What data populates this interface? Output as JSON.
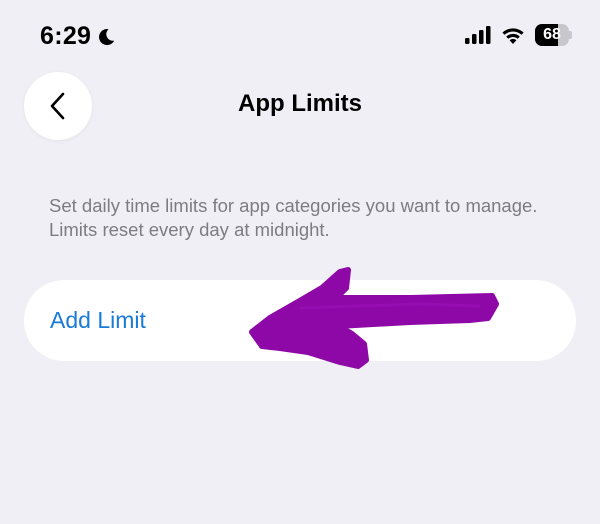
{
  "status_bar": {
    "time": "6:29",
    "focus_icon": "moon-icon",
    "signal_icon": "cellular-signal-icon",
    "wifi_icon": "wifi-icon",
    "battery_percent": "68",
    "battery_level": 0.68
  },
  "nav": {
    "back_icon": "chevron-left-icon",
    "title": "App Limits"
  },
  "description": "Set daily time limits for app categories you want to manage. Limits reset every day at midnight.",
  "add_limit": {
    "label": "Add Limit"
  },
  "annotation": {
    "type": "hand-drawn arrow",
    "color": "#8e08a8",
    "points_to": "Add Limit"
  },
  "colors": {
    "background": "#f0eff5",
    "card": "#ffffff",
    "link": "#1a7ad8",
    "secondary_text": "#7c7c82"
  }
}
